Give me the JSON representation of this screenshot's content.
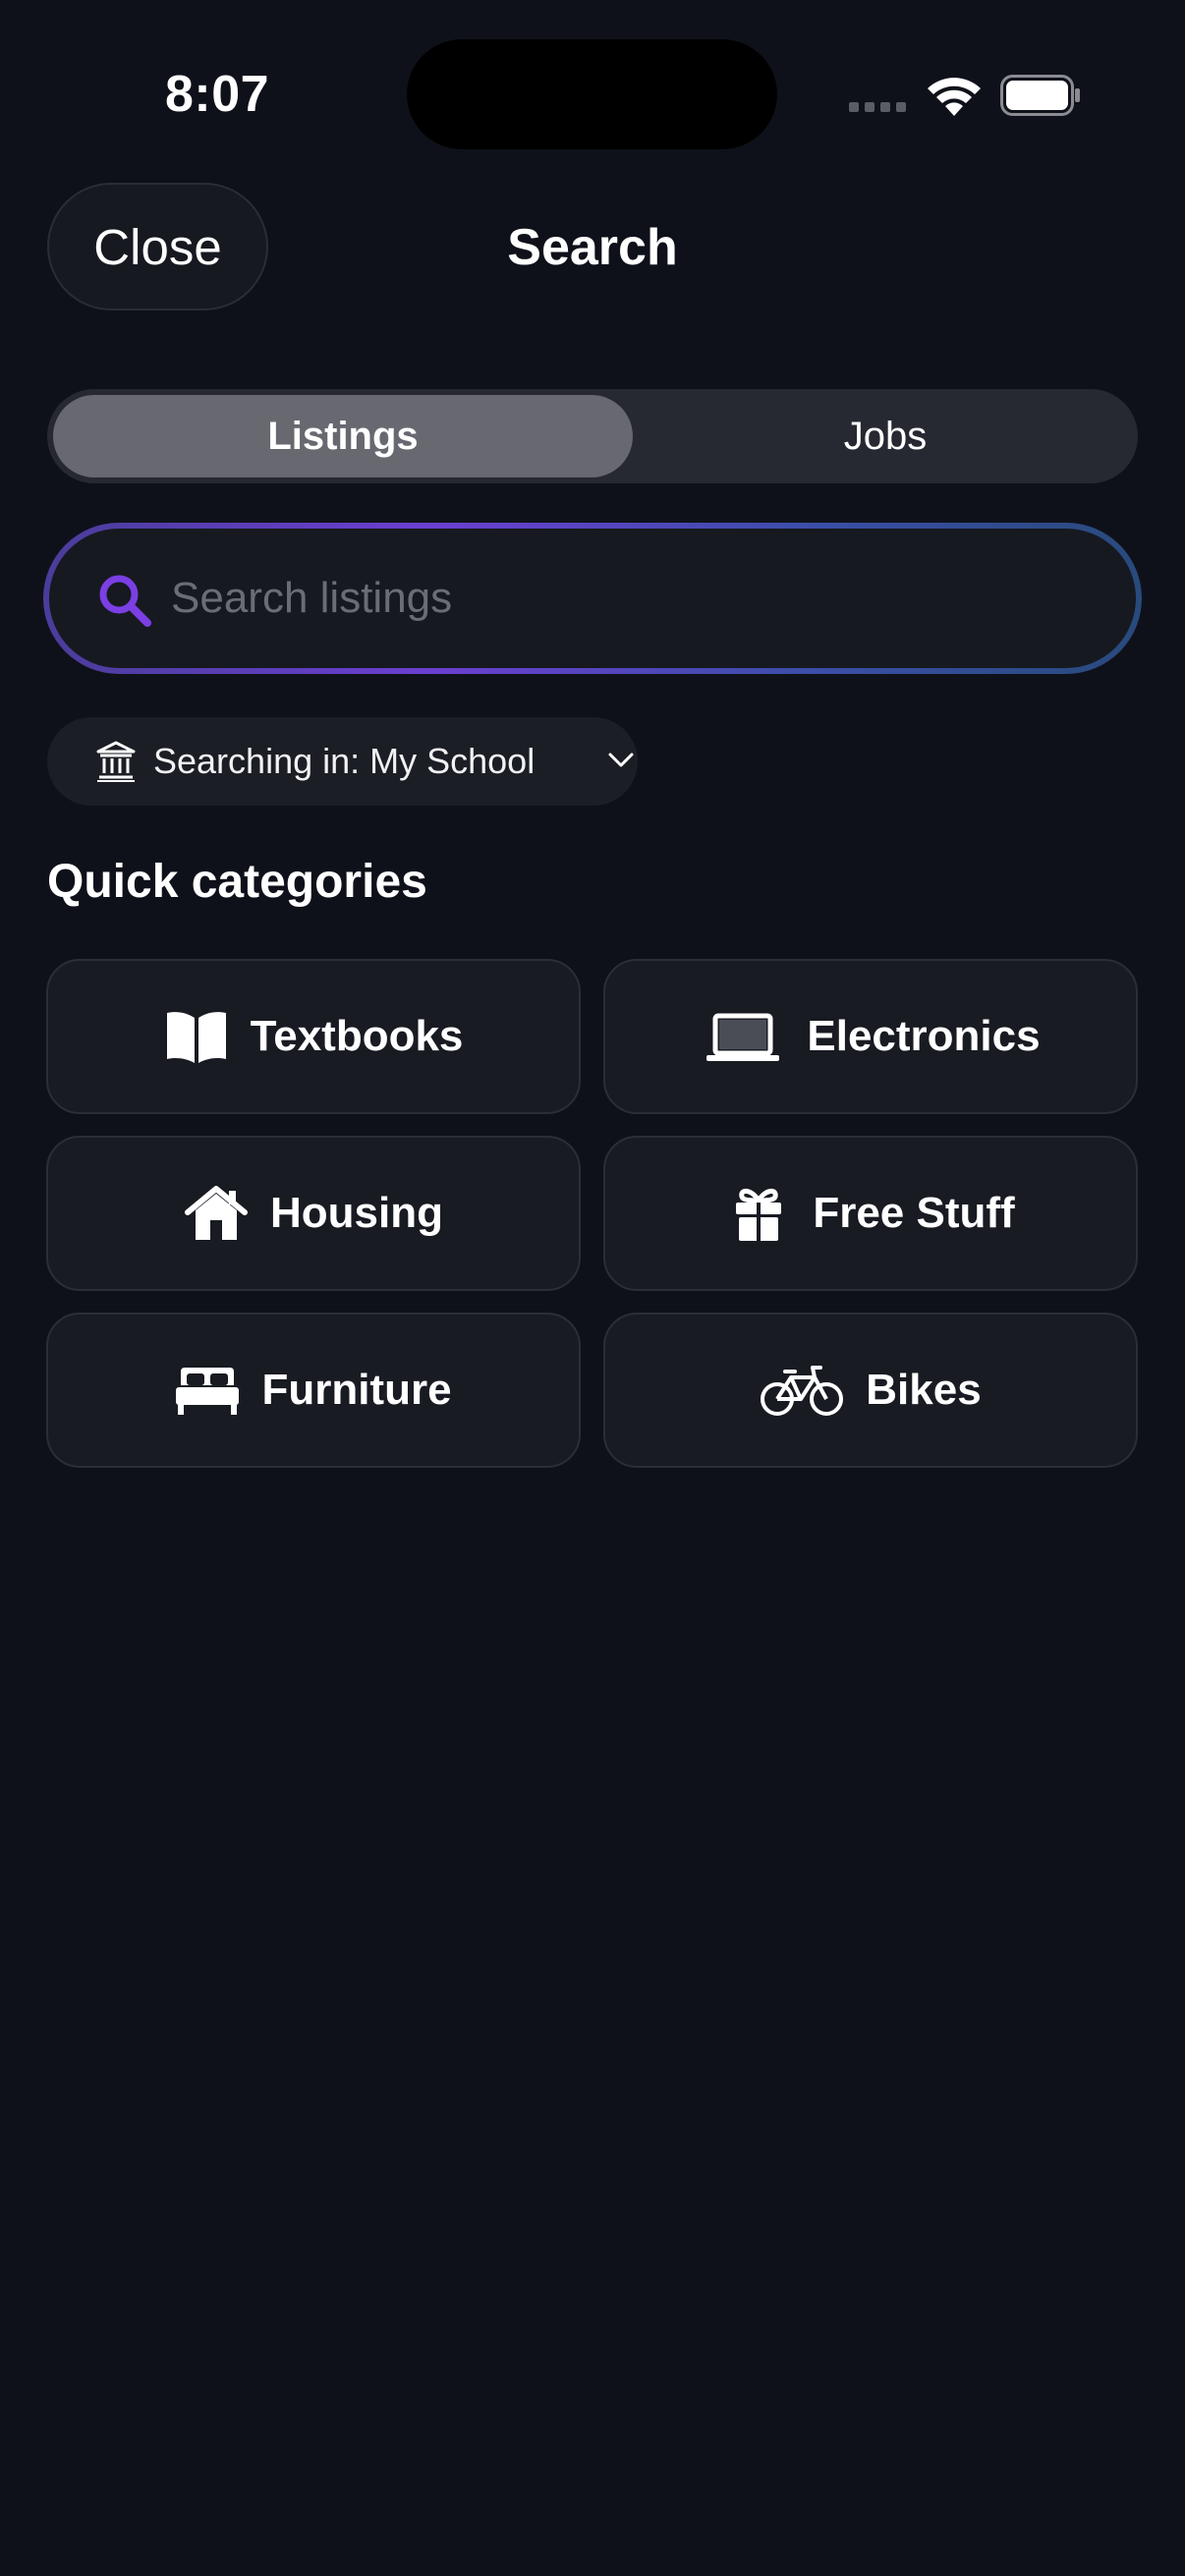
{
  "status_bar": {
    "time": "8:07"
  },
  "header": {
    "close_label": "Close",
    "title": "Search"
  },
  "segmented": {
    "tabs": [
      {
        "label": "Listings",
        "selected": true
      },
      {
        "label": "Jobs",
        "selected": false
      }
    ]
  },
  "search": {
    "value": "",
    "placeholder": "Search listings",
    "icon": "search-icon",
    "accent_color": "#7b3fe4"
  },
  "scope": {
    "label": "Searching in: My School",
    "icon": "institution-icon"
  },
  "quick_categories": {
    "title": "Quick categories",
    "items": [
      {
        "label": "Textbooks",
        "icon": "book-icon"
      },
      {
        "label": "Electronics",
        "icon": "laptop-icon"
      },
      {
        "label": "Housing",
        "icon": "house-icon"
      },
      {
        "label": "Free Stuff",
        "icon": "gift-icon"
      },
      {
        "label": "Furniture",
        "icon": "bed-icon"
      },
      {
        "label": "Bikes",
        "icon": "bicycle-icon"
      }
    ]
  }
}
